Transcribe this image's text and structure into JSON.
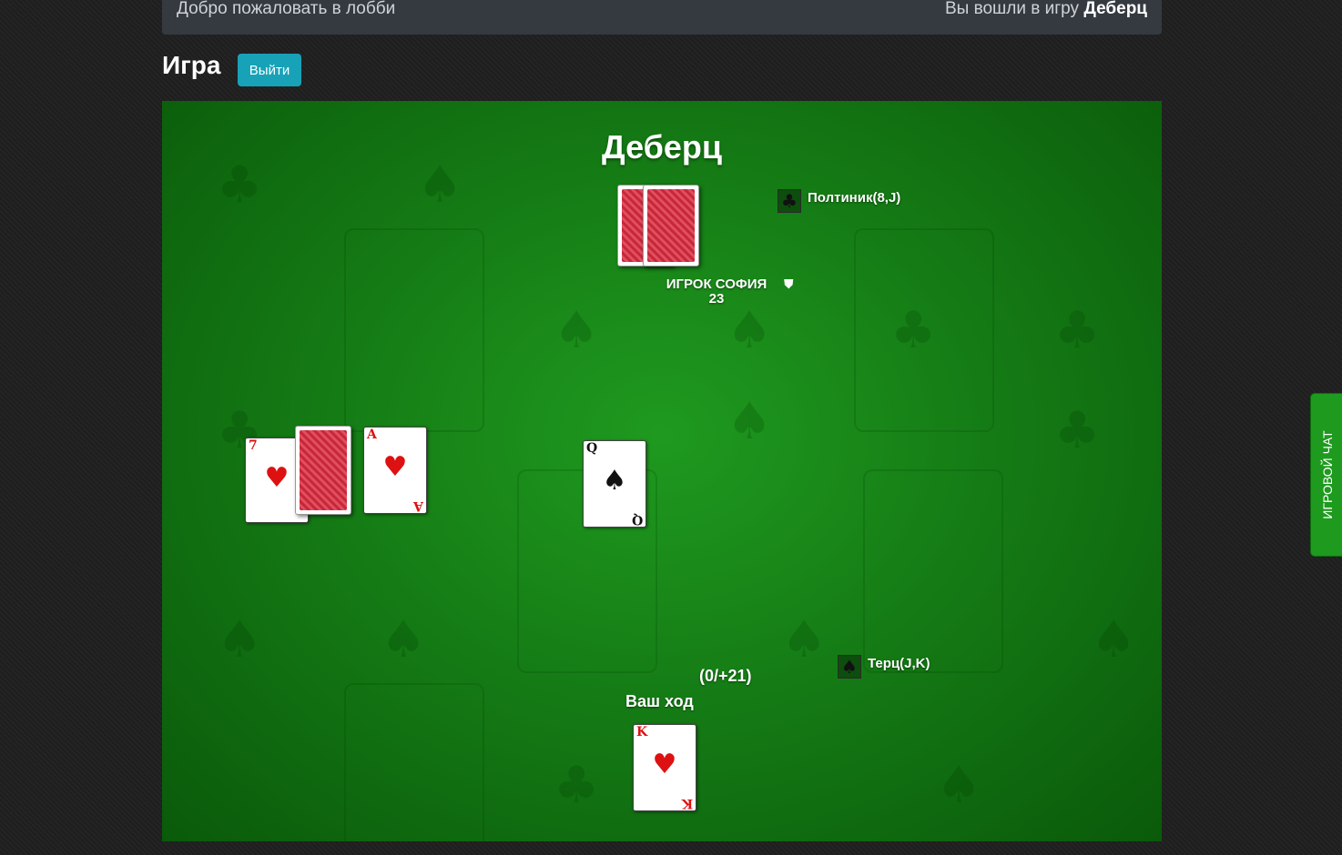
{
  "header": {
    "welcome": "Добро пожаловать в лобби",
    "joined_prefix": "Вы вошли в игру",
    "joined_game": "Деберц"
  },
  "page": {
    "title": "Игра",
    "exit_label": "Выйти"
  },
  "table": {
    "game_title": "Деберц",
    "opponent_top": {
      "name": "ИГРОК СОФИЯ",
      "score": "23",
      "shield_icon": "shield-icon"
    },
    "combination_top": {
      "suit_icon": "club-icon",
      "label": "Полтиник(8,J)"
    },
    "combination_bottom": {
      "suit_icon": "spade-icon",
      "label": "Терц(J,K)"
    },
    "score_delta": "(0/+21)",
    "turn_label": "Ваш ход",
    "left_cards": [
      {
        "rank": "7",
        "suit": "♥",
        "color": "red"
      },
      {
        "rank": "back"
      },
      {
        "rank": "A",
        "suit": "♥",
        "color": "red"
      }
    ],
    "center_card": {
      "rank": "Q",
      "suit": "♠",
      "color": "black"
    },
    "my_card": {
      "rank": "K",
      "suit": "♥",
      "color": "red"
    }
  },
  "chat": {
    "label": "ИГРОВОЙ ЧАТ"
  },
  "colors": {
    "table": "#137613",
    "exit_button": "#17a2b8",
    "chat_tab": "#1e9a1e"
  }
}
